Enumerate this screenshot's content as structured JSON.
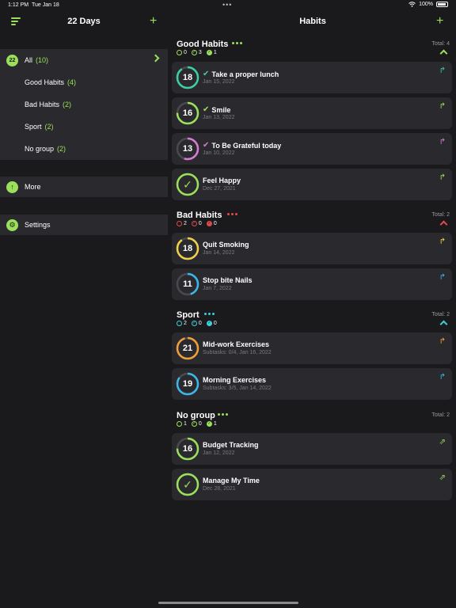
{
  "status_bar": {
    "time": "1:12 PM",
    "date": "Tue Jan 18",
    "battery": "100%"
  },
  "sidebar": {
    "title": "22 Days",
    "all": {
      "badge": "22",
      "label": "All",
      "count": "(10)"
    },
    "groups": [
      {
        "label": "Good Habits",
        "count": "(4)"
      },
      {
        "label": "Bad Habits",
        "count": "(2)"
      },
      {
        "label": "Sport",
        "count": "(2)"
      },
      {
        "label": "No group",
        "count": "(2)"
      }
    ],
    "more": "More",
    "settings": "Settings"
  },
  "main": {
    "title": "Habits",
    "groups": [
      {
        "name": "Good Habits",
        "total": "Total: 4",
        "accent": "#9be05a",
        "stats": [
          "0",
          "3",
          "1"
        ],
        "habits": [
          {
            "title": "Take a proper lunch",
            "sub": "Jan 15, 2022",
            "num": "18",
            "ring": "#3ecf9e",
            "progress": 0.9,
            "checked": true,
            "check_color": "#3ecf9e",
            "share": "#3ecf9e"
          },
          {
            "title": "Smile",
            "sub": "Jan 13, 2022",
            "num": "16",
            "ring": "#9be05a",
            "progress": 0.75,
            "checked": true,
            "check_color": "#9be05a",
            "share": "#9be05a"
          },
          {
            "title": "To Be Grateful today",
            "sub": "Jan 10, 2022",
            "num": "13",
            "ring": "#d87ad8",
            "progress": 0.55,
            "checked": true,
            "check_color": "#d87ad8",
            "share": "#d87ad8"
          },
          {
            "title": "Feel Happy",
            "sub": "Dec 27, 2021",
            "num": "",
            "ring": "#9be05a",
            "progress": 1.0,
            "checked": false,
            "done": true,
            "share": "#9be05a"
          }
        ]
      },
      {
        "name": "Bad Habits",
        "total": "Total: 2",
        "accent": "#e04a4a",
        "stats": [
          "2",
          "0",
          "0"
        ],
        "habits": [
          {
            "title": "Quit Smoking",
            "sub": "Jan 14, 2022",
            "num": "18",
            "ring": "#f0d04a",
            "progress": 0.9,
            "checked": false,
            "share": "#f0d04a"
          },
          {
            "title": "Stop bite Nails",
            "sub": "Jan 7, 2022",
            "num": "11",
            "ring": "#3ab8e8",
            "progress": 0.45,
            "checked": false,
            "share": "#3ab8e8"
          }
        ]
      },
      {
        "name": "Sport",
        "total": "Total: 2",
        "accent": "#3ed0d8",
        "stats": [
          "2",
          "0",
          "0"
        ],
        "habits": [
          {
            "title": "Mid-work Exercises",
            "sub": "Subtasks: 0/4, Jan 16, 2022",
            "num": "21",
            "ring": "#f0a03a",
            "progress": 0.95,
            "checked": false,
            "share": "#f0a03a"
          },
          {
            "title": "Morning Exercises",
            "sub": "Subtasks: 3/5, Jan 14, 2022",
            "num": "19",
            "ring": "#3ab8e8",
            "progress": 0.85,
            "checked": false,
            "share": "#3ab8e8"
          }
        ]
      },
      {
        "name": "No group",
        "total": "Total: 2",
        "accent": "#9be05a",
        "stats": [
          "1",
          "0",
          "1"
        ],
        "habits": [
          {
            "title": "Budget Tracking",
            "sub": "Jan 12, 2022",
            "num": "16",
            "ring": "#9be05a",
            "progress": 0.75,
            "checked": false,
            "share": "#9be05a"
          },
          {
            "title": "Manage My Time",
            "sub": "Dec 28, 2021",
            "num": "",
            "ring": "#9be05a",
            "progress": 1.0,
            "checked": false,
            "done": true,
            "share": "#9be05a"
          }
        ]
      }
    ]
  }
}
